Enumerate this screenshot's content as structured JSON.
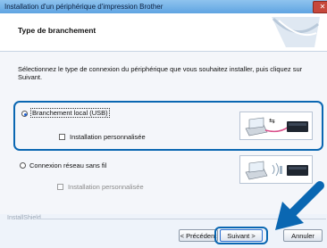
{
  "window": {
    "title": "Installation d'un périphérique d'impression Brother",
    "close_symbol": "✕"
  },
  "header": {
    "title": "Type de branchement"
  },
  "instructions": "Sélectionnez le type de connexion du périphérique que vous souhaitez installer, puis cliquez sur Suivant.",
  "options": {
    "local": {
      "label": "Branchement local (USB)",
      "selected": true,
      "custom_install_label": "Installation personnalisée",
      "custom_install_checked": false
    },
    "wireless": {
      "label": "Connexion réseau sans fil",
      "selected": false,
      "custom_install_label": "Installation personnalisée",
      "custom_install_checked": false
    }
  },
  "footer": {
    "brand": "InstallShield",
    "buttons": {
      "back": "< Précédent",
      "next": "Suivant >",
      "cancel": "Annuler"
    }
  },
  "colors": {
    "accent": "#0a67b2",
    "titlebar": "#5fa4e2",
    "close": "#c6473b"
  },
  "icons": [
    "usb-connection-icon",
    "wireless-connection-icon",
    "pointer-arrow-icon"
  ]
}
